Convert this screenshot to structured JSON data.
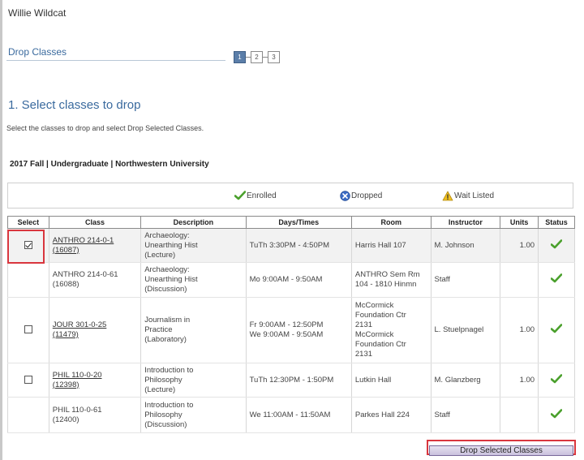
{
  "user": {
    "name": "Willie Wildcat"
  },
  "page": {
    "title": "Drop Classes",
    "steps": [
      "1",
      "2",
      "3"
    ],
    "section_heading": "1.  Select classes to drop",
    "instructions": "Select the classes to drop and select Drop Selected Classes.",
    "term": "2017 Fall | Undergraduate | Northwestern University"
  },
  "legend": {
    "enrolled": "Enrolled",
    "dropped": "Dropped",
    "wait_listed": "Wait Listed"
  },
  "table": {
    "headers": {
      "select": "Select",
      "class": "Class",
      "description": "Description",
      "days_times": "Days/Times",
      "room": "Room",
      "instructor": "Instructor",
      "units": "Units",
      "status": "Status"
    },
    "rows": [
      {
        "has_checkbox": true,
        "checked": true,
        "class_line1": "ANTHRO 214-0-1",
        "class_line2": "(16087)",
        "class_is_link": true,
        "desc_line1": "Archaeology:",
        "desc_line2": "Unearthing Hist",
        "desc_line3": "(Lecture)",
        "days_line1": "TuTh 3:30PM - 4:50PM",
        "days_line2": "",
        "room_line1": "Harris Hall 107",
        "room_line2": "",
        "room_line3": "",
        "room_line4": "",
        "instructor": "M. Johnson",
        "units": "1.00",
        "status": "enrolled"
      },
      {
        "has_checkbox": false,
        "checked": false,
        "class_line1": "ANTHRO 214-0-61",
        "class_line2": "(16088)",
        "class_is_link": false,
        "desc_line1": "Archaeology:",
        "desc_line2": "Unearthing Hist",
        "desc_line3": "(Discussion)",
        "days_line1": "Mo 9:00AM - 9:50AM",
        "days_line2": "",
        "room_line1": "ANTHRO Sem Rm",
        "room_line2": "104 - 1810 Hinmn",
        "room_line3": "",
        "room_line4": "",
        "instructor": "Staff",
        "units": "",
        "status": "enrolled"
      },
      {
        "has_checkbox": true,
        "checked": false,
        "class_line1": "JOUR 301-0-25",
        "class_line2": "(11479)",
        "class_is_link": true,
        "desc_line1": "Journalism in",
        "desc_line2": "Practice",
        "desc_line3": "(Laboratory)",
        "days_line1": "Fr 9:00AM - 12:50PM",
        "days_line2": "We 9:00AM - 9:50AM",
        "room_line1": "McCormick",
        "room_line2": "Foundation Ctr",
        "room_line3": "2131",
        "room_line4": "McCormick",
        "room_line5": "Foundation Ctr",
        "room_line6": "2131",
        "instructor": "L. Stuelpnagel",
        "units": "1.00",
        "status": "enrolled"
      },
      {
        "has_checkbox": true,
        "checked": false,
        "class_line1": "PHIL 110-0-20",
        "class_line2": "(12398)",
        "class_is_link": true,
        "desc_line1": "Introduction to",
        "desc_line2": "Philosophy",
        "desc_line3": "(Lecture)",
        "days_line1": "TuTh 12:30PM - 1:50PM",
        "days_line2": "",
        "room_line1": "Lutkin Hall",
        "room_line2": "",
        "room_line3": "",
        "room_line4": "",
        "instructor": "M. Glanzberg",
        "units": "1.00",
        "status": "enrolled"
      },
      {
        "has_checkbox": false,
        "checked": false,
        "class_line1": "PHIL 110-0-61",
        "class_line2": "(12400)",
        "class_is_link": false,
        "desc_line1": "Introduction to",
        "desc_line2": "Philosophy",
        "desc_line3": "(Discussion)",
        "days_line1": "We 11:00AM - 11:50AM",
        "days_line2": "",
        "room_line1": "Parkes Hall 224",
        "room_line2": "",
        "room_line3": "",
        "room_line4": "",
        "instructor": "Staff",
        "units": "",
        "status": "enrolled"
      }
    ]
  },
  "actions": {
    "drop_selected": "Drop Selected Classes"
  },
  "colors": {
    "link_blue": "#3a6a9e",
    "enrolled_green": "#4aa02c",
    "dropped_blue": "#3b6bc4",
    "waitlist_yellow": "#f0c020",
    "highlight_red": "#d9363e"
  }
}
